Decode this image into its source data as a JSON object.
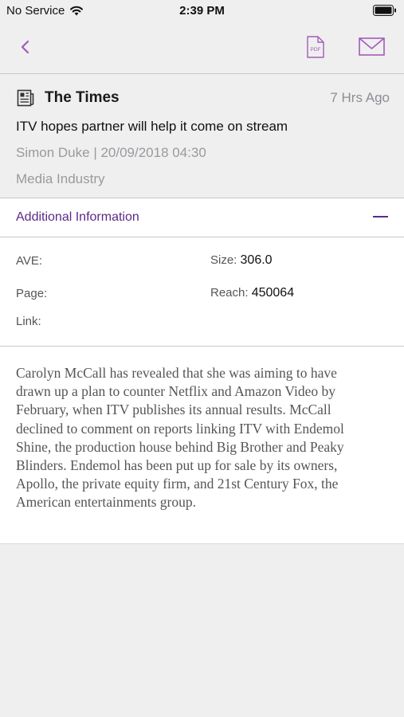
{
  "status_bar": {
    "carrier": "No Service",
    "time": "2:39 PM"
  },
  "nav": {
    "back_icon": "chevron-left-icon",
    "pdf_icon": "pdf-icon",
    "pdf_label": "PDF",
    "mail_icon": "envelope-icon"
  },
  "article": {
    "source": "The Times",
    "age": "7 Hrs Ago",
    "headline": "ITV hopes partner will help it come on stream",
    "byline": "Simon Duke | 20/09/2018 04:30",
    "category": "Media Industry"
  },
  "additional_info": {
    "title": "Additional Information",
    "ave_label": "AVE:",
    "ave_value": "",
    "size_label": "Size:",
    "size_value": "306.0",
    "page_label": "Page:",
    "page_value": "",
    "reach_label": "Reach:",
    "reach_value": "450064",
    "link_label": "Link:",
    "link_value": ""
  },
  "body": "Carolyn McCall has revealed that she was aiming to have drawn up a plan to counter Netflix and Amazon Video by February, when ITV publishes its annual results. McCall declined to comment on reports linking ITV with Endemol Shine, the production house behind Big Brother and Peaky Blinders. Endemol has been put up for sale by its owners, Apollo, the private equity firm, and 21st Century Fox, the American entertainments group.",
  "colors": {
    "accent": "#5b2a86",
    "icon_tint": "#a35bb8",
    "background": "#efeff0",
    "muted_text": "#9a9a9e"
  }
}
